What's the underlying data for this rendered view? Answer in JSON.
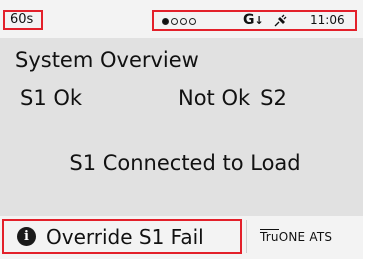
{
  "status_bar": {
    "timer": "60s",
    "page_indicator": {
      "total": 4,
      "active": 1
    },
    "generator_icon_label": "G",
    "generator_arrow": "↓",
    "time": "11:06"
  },
  "main": {
    "title": "System Overview",
    "s1_status": "S1  Ok",
    "s2_status_text": "Not Ok",
    "s2_label": "S2",
    "connection": "S1 Connected to Load"
  },
  "bottom_bar": {
    "alert_icon": "i",
    "alert_text": "Override S1 Fail",
    "brand_prefix": "Tru",
    "brand_suffix": "ONE ATS"
  },
  "colors": {
    "screen_bg": "#e1e1e1",
    "bar_bg": "#f3f3f3",
    "highlight": "#e3202a"
  },
  "icons": [
    "page-dots",
    "generator-icon",
    "plug-icon",
    "info-icon"
  ]
}
